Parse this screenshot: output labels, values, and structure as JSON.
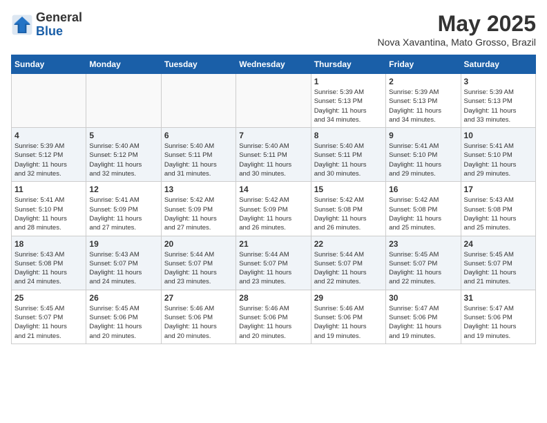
{
  "logo": {
    "general": "General",
    "blue": "Blue"
  },
  "title": "May 2025",
  "location": "Nova Xavantina, Mato Grosso, Brazil",
  "weekdays": [
    "Sunday",
    "Monday",
    "Tuesday",
    "Wednesday",
    "Thursday",
    "Friday",
    "Saturday"
  ],
  "weeks": [
    [
      {
        "day": "",
        "info": ""
      },
      {
        "day": "",
        "info": ""
      },
      {
        "day": "",
        "info": ""
      },
      {
        "day": "",
        "info": ""
      },
      {
        "day": "1",
        "info": "Sunrise: 5:39 AM\nSunset: 5:13 PM\nDaylight: 11 hours\nand 34 minutes."
      },
      {
        "day": "2",
        "info": "Sunrise: 5:39 AM\nSunset: 5:13 PM\nDaylight: 11 hours\nand 34 minutes."
      },
      {
        "day": "3",
        "info": "Sunrise: 5:39 AM\nSunset: 5:13 PM\nDaylight: 11 hours\nand 33 minutes."
      }
    ],
    [
      {
        "day": "4",
        "info": "Sunrise: 5:39 AM\nSunset: 5:12 PM\nDaylight: 11 hours\nand 32 minutes."
      },
      {
        "day": "5",
        "info": "Sunrise: 5:40 AM\nSunset: 5:12 PM\nDaylight: 11 hours\nand 32 minutes."
      },
      {
        "day": "6",
        "info": "Sunrise: 5:40 AM\nSunset: 5:11 PM\nDaylight: 11 hours\nand 31 minutes."
      },
      {
        "day": "7",
        "info": "Sunrise: 5:40 AM\nSunset: 5:11 PM\nDaylight: 11 hours\nand 30 minutes."
      },
      {
        "day": "8",
        "info": "Sunrise: 5:40 AM\nSunset: 5:11 PM\nDaylight: 11 hours\nand 30 minutes."
      },
      {
        "day": "9",
        "info": "Sunrise: 5:41 AM\nSunset: 5:10 PM\nDaylight: 11 hours\nand 29 minutes."
      },
      {
        "day": "10",
        "info": "Sunrise: 5:41 AM\nSunset: 5:10 PM\nDaylight: 11 hours\nand 29 minutes."
      }
    ],
    [
      {
        "day": "11",
        "info": "Sunrise: 5:41 AM\nSunset: 5:10 PM\nDaylight: 11 hours\nand 28 minutes."
      },
      {
        "day": "12",
        "info": "Sunrise: 5:41 AM\nSunset: 5:09 PM\nDaylight: 11 hours\nand 27 minutes."
      },
      {
        "day": "13",
        "info": "Sunrise: 5:42 AM\nSunset: 5:09 PM\nDaylight: 11 hours\nand 27 minutes."
      },
      {
        "day": "14",
        "info": "Sunrise: 5:42 AM\nSunset: 5:09 PM\nDaylight: 11 hours\nand 26 minutes."
      },
      {
        "day": "15",
        "info": "Sunrise: 5:42 AM\nSunset: 5:08 PM\nDaylight: 11 hours\nand 26 minutes."
      },
      {
        "day": "16",
        "info": "Sunrise: 5:42 AM\nSunset: 5:08 PM\nDaylight: 11 hours\nand 25 minutes."
      },
      {
        "day": "17",
        "info": "Sunrise: 5:43 AM\nSunset: 5:08 PM\nDaylight: 11 hours\nand 25 minutes."
      }
    ],
    [
      {
        "day": "18",
        "info": "Sunrise: 5:43 AM\nSunset: 5:08 PM\nDaylight: 11 hours\nand 24 minutes."
      },
      {
        "day": "19",
        "info": "Sunrise: 5:43 AM\nSunset: 5:07 PM\nDaylight: 11 hours\nand 24 minutes."
      },
      {
        "day": "20",
        "info": "Sunrise: 5:44 AM\nSunset: 5:07 PM\nDaylight: 11 hours\nand 23 minutes."
      },
      {
        "day": "21",
        "info": "Sunrise: 5:44 AM\nSunset: 5:07 PM\nDaylight: 11 hours\nand 23 minutes."
      },
      {
        "day": "22",
        "info": "Sunrise: 5:44 AM\nSunset: 5:07 PM\nDaylight: 11 hours\nand 22 minutes."
      },
      {
        "day": "23",
        "info": "Sunrise: 5:45 AM\nSunset: 5:07 PM\nDaylight: 11 hours\nand 22 minutes."
      },
      {
        "day": "24",
        "info": "Sunrise: 5:45 AM\nSunset: 5:07 PM\nDaylight: 11 hours\nand 21 minutes."
      }
    ],
    [
      {
        "day": "25",
        "info": "Sunrise: 5:45 AM\nSunset: 5:07 PM\nDaylight: 11 hours\nand 21 minutes."
      },
      {
        "day": "26",
        "info": "Sunrise: 5:45 AM\nSunset: 5:06 PM\nDaylight: 11 hours\nand 20 minutes."
      },
      {
        "day": "27",
        "info": "Sunrise: 5:46 AM\nSunset: 5:06 PM\nDaylight: 11 hours\nand 20 minutes."
      },
      {
        "day": "28",
        "info": "Sunrise: 5:46 AM\nSunset: 5:06 PM\nDaylight: 11 hours\nand 20 minutes."
      },
      {
        "day": "29",
        "info": "Sunrise: 5:46 AM\nSunset: 5:06 PM\nDaylight: 11 hours\nand 19 minutes."
      },
      {
        "day": "30",
        "info": "Sunrise: 5:47 AM\nSunset: 5:06 PM\nDaylight: 11 hours\nand 19 minutes."
      },
      {
        "day": "31",
        "info": "Sunrise: 5:47 AM\nSunset: 5:06 PM\nDaylight: 11 hours\nand 19 minutes."
      }
    ]
  ]
}
